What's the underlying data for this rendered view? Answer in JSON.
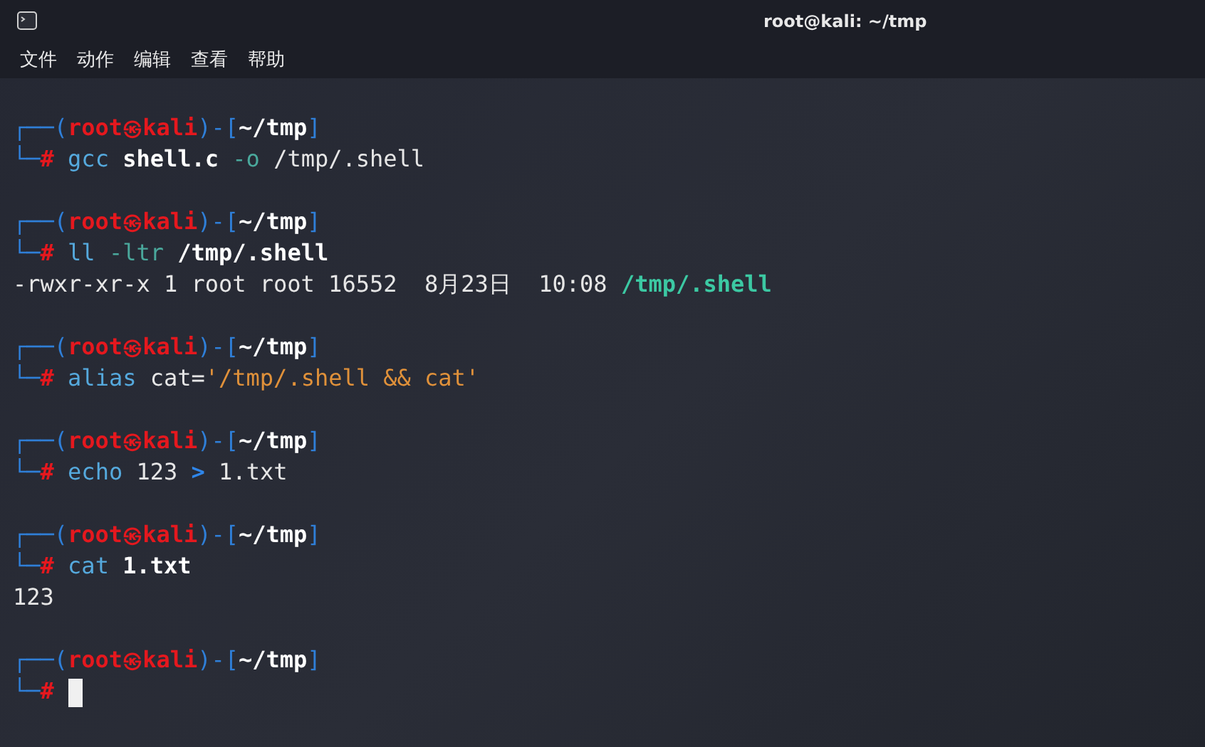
{
  "window": {
    "title": "root@kali: ~/tmp"
  },
  "menu": [
    "文件",
    "动作",
    "编辑",
    "查看",
    "帮助"
  ],
  "blocks": [
    {
      "prompt": {
        "lead": "┌──(",
        "user": "root",
        "at": "㉿",
        "host": "kali",
        "sep": ")-[",
        "path": "~/tmp",
        "tail": "]",
        "corner": "└─",
        "sign": "#"
      },
      "command": [
        {
          "kind": "command",
          "text": "gcc"
        },
        {
          "kind": "bold",
          "text": "shell.c"
        },
        {
          "kind": "option",
          "text": "-o"
        },
        {
          "kind": "plain",
          "text": "/tmp/.shell"
        }
      ]
    },
    {
      "prompt": {
        "lead": "┌──(",
        "user": "root",
        "at": "㉿",
        "host": "kali",
        "sep": ")-[",
        "path": "~/tmp",
        "tail": "]",
        "corner": "└─",
        "sign": "#"
      },
      "command": [
        {
          "kind": "command",
          "text": "ll"
        },
        {
          "kind": "option",
          "text": "-ltr"
        },
        {
          "kind": "bold",
          "text": "/tmp/.shell"
        }
      ],
      "output": [
        [
          {
            "kind": "plain",
            "text": "-rwxr-xr-x 1 root root 16552  8月23日  10:08"
          },
          {
            "kind": "executable",
            "text": "/tmp/.shell"
          }
        ]
      ]
    },
    {
      "prompt": {
        "lead": "┌──(",
        "user": "root",
        "at": "㉿",
        "host": "kali",
        "sep": ")-[",
        "path": "~/tmp",
        "tail": "]",
        "corner": "└─",
        "sign": "#"
      },
      "command": [
        {
          "kind": "command",
          "text": "alias"
        },
        {
          "kind": "plain",
          "text": "cat="
        },
        {
          "kind": "string",
          "text": "'/tmp/.shell && cat'",
          "gap": false
        }
      ]
    },
    {
      "prompt": {
        "lead": "┌──(",
        "user": "root",
        "at": "㉿",
        "host": "kali",
        "sep": ")-[",
        "path": "~/tmp",
        "tail": "]",
        "corner": "└─",
        "sign": "#"
      },
      "command": [
        {
          "kind": "command",
          "text": "echo"
        },
        {
          "kind": "plain",
          "text": "123"
        },
        {
          "kind": "operator",
          "text": ">"
        },
        {
          "kind": "plain",
          "text": "1.txt"
        }
      ]
    },
    {
      "prompt": {
        "lead": "┌──(",
        "user": "root",
        "at": "㉿",
        "host": "kali",
        "sep": ")-[",
        "path": "~/tmp",
        "tail": "]",
        "corner": "└─",
        "sign": "#"
      },
      "command": [
        {
          "kind": "command",
          "text": "cat"
        },
        {
          "kind": "bold",
          "text": "1.txt"
        }
      ],
      "output": [
        [
          {
            "kind": "plain",
            "text": "123"
          }
        ]
      ]
    },
    {
      "prompt": {
        "lead": "┌──(",
        "user": "root",
        "at": "㉿",
        "host": "kali",
        "sep": ")-[",
        "path": "~/tmp",
        "tail": "]",
        "corner": "└─",
        "sign": "#"
      },
      "cursor": true
    }
  ]
}
